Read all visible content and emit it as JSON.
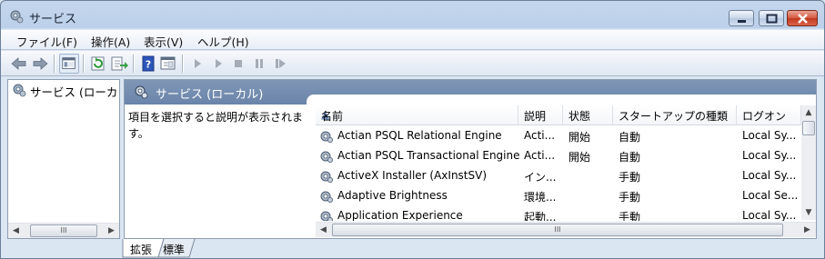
{
  "window": {
    "title": "サービス"
  },
  "menu": [
    "ファイル(F)",
    "操作(A)",
    "表示(V)",
    "ヘルプ(H)"
  ],
  "toolbar": {
    "buttons": [
      "back-icon",
      "forward-icon",
      "console-tree-icon",
      "refresh-icon",
      "export-list-icon",
      "help-icon",
      "properties-icon",
      "start-service-icon",
      "start-service-alt-icon",
      "stop-service-icon",
      "pause-service-icon",
      "restart-service-icon"
    ]
  },
  "tree": {
    "root_label": "サービス (ローカ",
    "hscroll_thumb": "III"
  },
  "pane": {
    "header": "サービス (ローカル)",
    "description": "項目を選択すると説明が表示されます。"
  },
  "list": {
    "columns": [
      "名前",
      "説明",
      "状態",
      "スタートアップの種類",
      "ログオン"
    ],
    "rows": [
      [
        "Actian PSQL Relational Engine",
        "Acti...",
        "開始",
        "自動",
        "Local Sy..."
      ],
      [
        "Actian PSQL Transactional Engine",
        "Acti...",
        "開始",
        "自動",
        "Local Sy..."
      ],
      [
        "ActiveX Installer (AxInstSV)",
        "イン...",
        "",
        "手動",
        "Local Sy..."
      ],
      [
        "Adaptive Brightness",
        "環境...",
        "",
        "手動",
        "Local Se..."
      ],
      [
        "Application Experience",
        "起動...",
        "",
        "手動",
        "Local Sy..."
      ]
    ],
    "hscroll_thumb": "III"
  },
  "tabs": [
    "拡張",
    "標準"
  ],
  "colors": {
    "header_blue": "#7189ae",
    "close_red": "#c8412a"
  }
}
